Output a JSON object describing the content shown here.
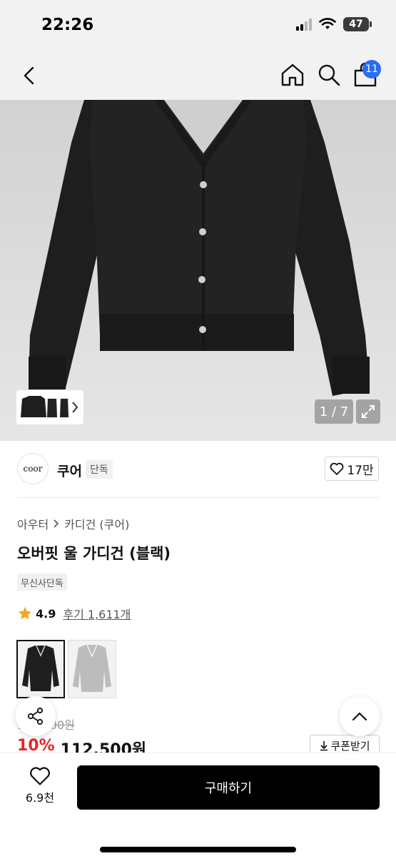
{
  "status_bar": {
    "time": "22:26",
    "battery": "47"
  },
  "nav": {
    "cart_count": "11"
  },
  "gallery": {
    "counter": "1 / 7"
  },
  "brand": {
    "logo_text": "coor",
    "name": "쿠어",
    "tag": "단독",
    "likes": "17만"
  },
  "product": {
    "breadcrumb": [
      "아우터",
      "카디건 (쿠어)"
    ],
    "title": "오버핏 울 가디건 (블랙)",
    "exclusive_label": "무신사단독",
    "rating": "4.9",
    "reviews": "후기 1,611개",
    "colors": [
      "black",
      "light-gray"
    ]
  },
  "price": {
    "original": "125,000원",
    "discount": "10%",
    "sale": "112,500원",
    "coupon_label": "쿠폰받기"
  },
  "bottom": {
    "wish_count": "6.9천",
    "buy_label": "구매하기"
  },
  "colors": {
    "accent_blue": "#2a6df4",
    "discount_red": "#e8262b",
    "star": "#f5a623"
  }
}
